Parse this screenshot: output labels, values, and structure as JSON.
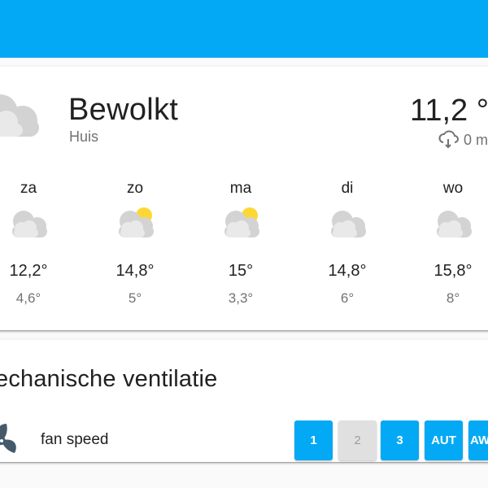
{
  "header": {
    "color": "#03a9f4"
  },
  "weather": {
    "condition": "Bewolkt",
    "location": "Huis",
    "temperature": "11,2 °",
    "precipitation": "0 m",
    "main_icon": "cloudy-icon",
    "forecast": [
      {
        "day": "za",
        "icon": "cloudy-icon",
        "high": "12,2°",
        "low": "4,6°"
      },
      {
        "day": "zo",
        "icon": "partly-cloudy-icon",
        "high": "14,8°",
        "low": "5°"
      },
      {
        "day": "ma",
        "icon": "partly-cloudy-icon",
        "high": "15°",
        "low": "3,3°"
      },
      {
        "day": "di",
        "icon": "cloudy-icon",
        "high": "14,8°",
        "low": "6°"
      },
      {
        "day": "wo",
        "icon": "cloudy-icon",
        "high": "15,8°",
        "low": "8°"
      }
    ]
  },
  "ventilation": {
    "title": "echanische ventilatie",
    "row_label": "fan speed",
    "row_icon": "fan-icon",
    "buttons": [
      {
        "label": "1",
        "active": true
      },
      {
        "label": "2",
        "active": false
      },
      {
        "label": "3",
        "active": true
      },
      {
        "label": "AUT",
        "active": true
      },
      {
        "label": "AW",
        "active": true
      }
    ]
  }
}
